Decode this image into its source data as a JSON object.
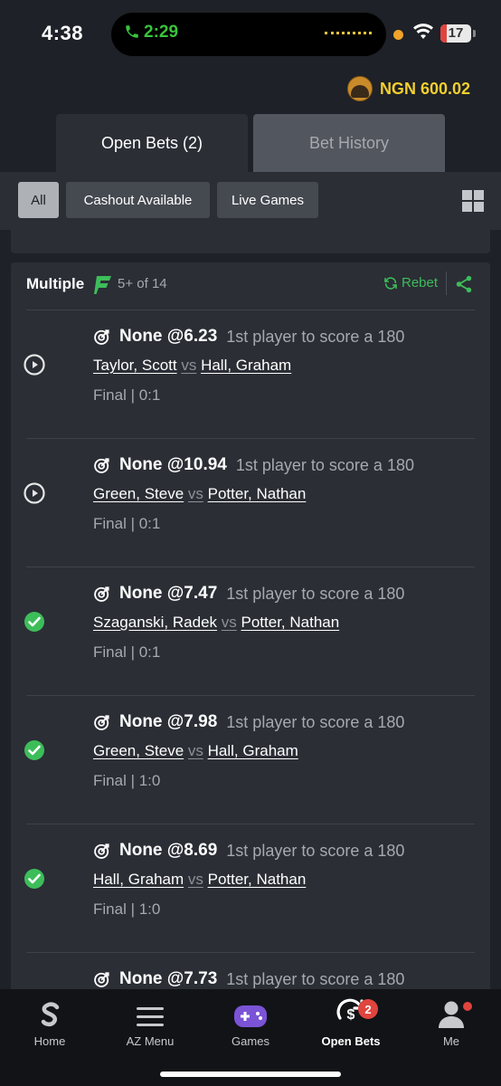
{
  "status_bar": {
    "time": "4:38",
    "call_time": "2:29",
    "battery": "17"
  },
  "account": {
    "balance": "NGN 600.02"
  },
  "tabs": [
    {
      "label": "Open Bets (2)"
    },
    {
      "label": "Bet History"
    }
  ],
  "filters": [
    {
      "label": "All"
    },
    {
      "label": "Cashout Available"
    },
    {
      "label": "Live Games"
    }
  ],
  "bet": {
    "type": "Multiple",
    "count": "5+ of 14",
    "rebet_label": "Rebet",
    "legs": [
      {
        "status": "live",
        "pick": "None @6.23",
        "market": "1st player to score a 180",
        "home": "Taylor, Scott",
        "vs": "vs",
        "away": "Hall, Graham",
        "result": "Final | 0:1"
      },
      {
        "status": "live",
        "pick": "None @10.94",
        "market": "1st player to score a 180",
        "home": "Green, Steve",
        "vs": "vs",
        "away": "Potter, Nathan",
        "result": "Final | 0:1"
      },
      {
        "status": "won",
        "pick": "None @7.47",
        "market": "1st player to score a 180",
        "home": "Szaganski, Radek",
        "vs": "vs",
        "away": "Potter, Nathan",
        "result": "Final | 0:1"
      },
      {
        "status": "won",
        "pick": "None @7.98",
        "market": "1st player to score a 180",
        "home": "Green, Steve",
        "vs": "vs",
        "away": "Hall, Graham",
        "result": "Final | 1:0"
      },
      {
        "status": "won",
        "pick": "None @8.69",
        "market": "1st player to score a 180",
        "home": "Hall, Graham",
        "vs": "vs",
        "away": "Potter, Nathan",
        "result": "Final | 1:0"
      },
      {
        "status": "",
        "pick": "None @7.73",
        "market": "1st player to score a 180"
      }
    ]
  },
  "nav": {
    "items": [
      {
        "label": "Home",
        "icon": "sportybet-logo-icon"
      },
      {
        "label": "AZ Menu",
        "icon": "menu-icon"
      },
      {
        "label": "Games",
        "icon": "gamepad-icon"
      },
      {
        "label": "Open Bets",
        "icon": "open-bets-icon",
        "badge": "2"
      },
      {
        "label": "Me",
        "icon": "user-icon"
      }
    ]
  },
  "colors": {
    "accent_green": "#3dbd5a",
    "balance_yellow": "#f2cf2f",
    "badge_red": "#e0443e"
  }
}
